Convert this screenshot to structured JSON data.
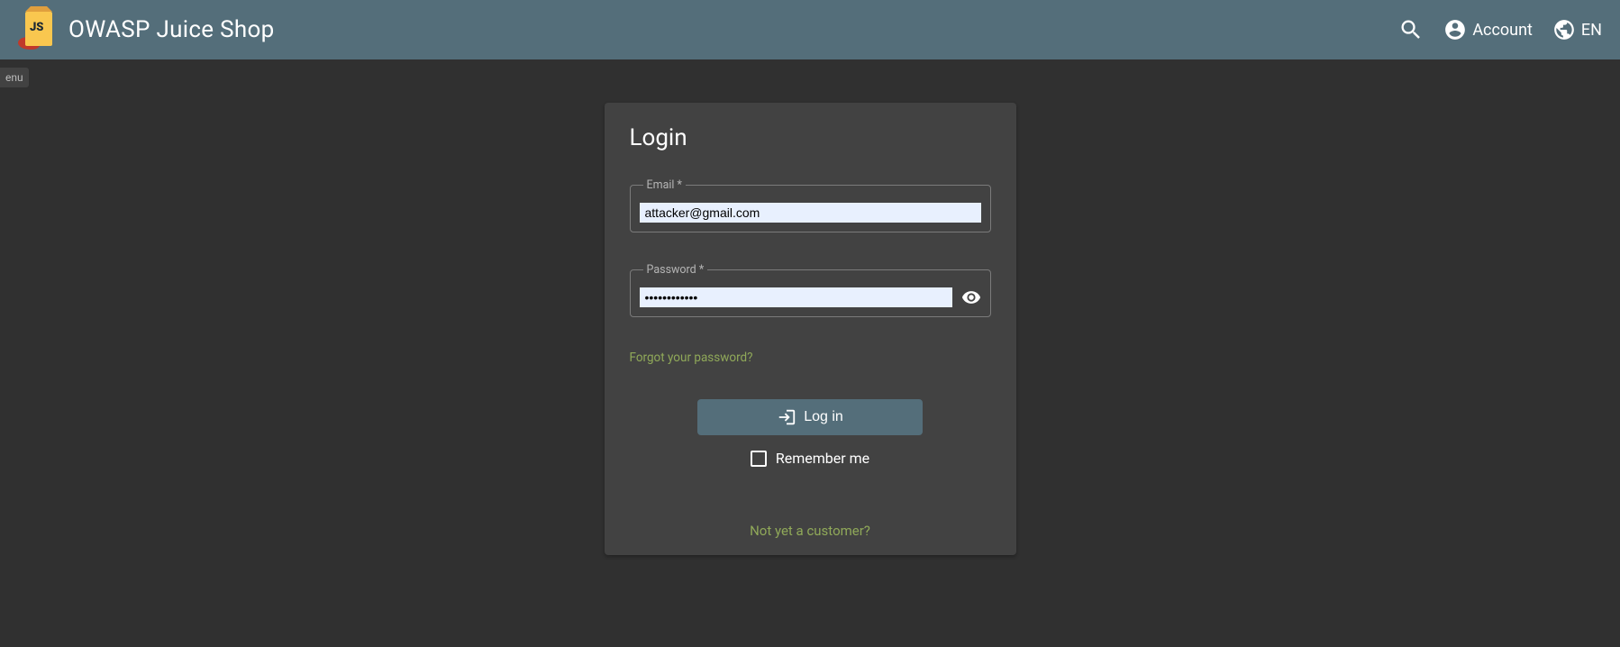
{
  "header": {
    "app_title": "OWASP Juice Shop",
    "account_label": "Account",
    "language_label": "EN"
  },
  "hidden_tab": "enu",
  "login": {
    "title": "Login",
    "email_label": "Email *",
    "email_value": "attacker@gmail.com",
    "password_label": "Password *",
    "password_value": "••••••••••••",
    "forgot_link": "Forgot your password?",
    "login_button": "Log in",
    "remember_label": "Remember me",
    "register_link": "Not yet a customer?"
  }
}
